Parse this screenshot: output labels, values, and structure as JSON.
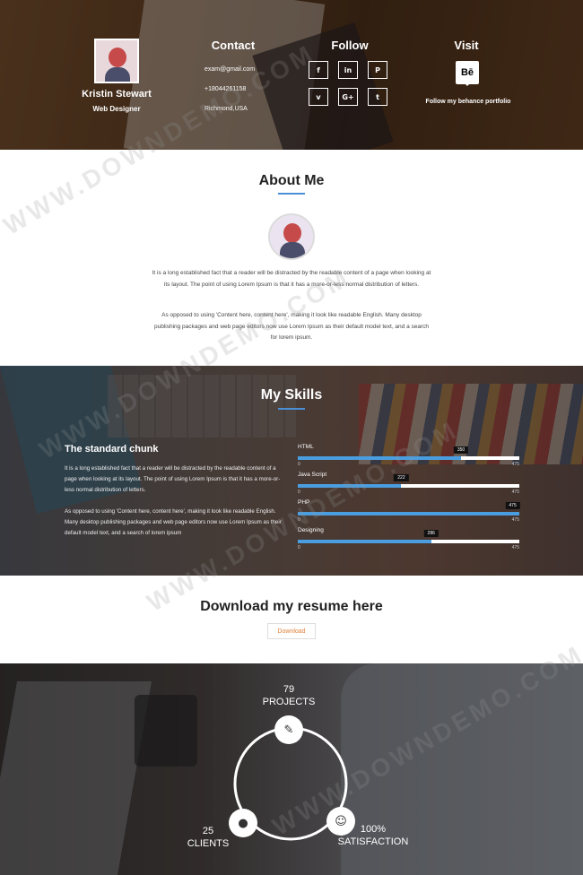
{
  "profile": {
    "name": "Kristin Stewart",
    "role": "Web Designer"
  },
  "contact": {
    "title": "Contact",
    "email": "exam@gmail.com",
    "phone": "+18044261158",
    "location": "Richmond,USA"
  },
  "follow": {
    "title": "Follow",
    "icons": [
      {
        "name": "facebook-icon",
        "glyph": "f"
      },
      {
        "name": "linkedin-icon",
        "glyph": "in"
      },
      {
        "name": "pinterest-icon",
        "glyph": "P"
      },
      {
        "name": "vimeo-icon",
        "glyph": "v"
      },
      {
        "name": "google-plus-icon",
        "glyph": "G+"
      },
      {
        "name": "tumblr-icon",
        "glyph": "t"
      }
    ]
  },
  "visit": {
    "title": "Visit",
    "icon": "behance-icon",
    "icon_text": "Bē",
    "text": "Follow my behance portfolio"
  },
  "about": {
    "title": "About Me",
    "p1": "It is a long established fact that a reader will be distracted by the readable content of a page when looking at its layout. The point of using Lorem Ipsum is that it has a more-or-less normal distribution of letters.",
    "p2": "As opposed to using 'Content here, content here', making it look like readable English. Many desktop publishing packages and web page editors now use Lorem Ipsum as their default model text, and a search for lorem ipsum."
  },
  "skills": {
    "title": "My Skills",
    "chunk_title": "The standard chunk",
    "chunk_p1": "It is a long established fact that a reader will be distracted by the readable content of a page when looking at its layout. The point of using Lorem Ipsum is that it has a more-or-less normal distribution of letters.",
    "chunk_p2": "As opposed to using 'Content here, content here', making it look like readable English. Many desktop publishing packages and web page editors now use Lorem Ipsum as their default model text, and a search of lorem ipsum",
    "bars": [
      {
        "label": "HTML",
        "value": 350,
        "max": 475,
        "min_label": "0",
        "max_label": "475"
      },
      {
        "label": "Java Script",
        "value": 222,
        "max": 475,
        "min_label": "0",
        "max_label": "475"
      },
      {
        "label": "PHP",
        "value": 475,
        "max": 475,
        "min_label": "0",
        "max_label": "475"
      },
      {
        "label": "Designing",
        "value": 286,
        "max": 475,
        "min_label": "0",
        "max_label": "475"
      }
    ]
  },
  "resume": {
    "title": "Download my resume here",
    "button": "Download"
  },
  "stats": {
    "projects": {
      "num": "79",
      "label": "PROJECTS",
      "icon": "edit-icon"
    },
    "clients": {
      "num": "25",
      "label": "CLIENTS",
      "icon": "user-icon"
    },
    "satisfaction": {
      "num": "100%",
      "label": "SATISFACTION",
      "icon": "smile-icon"
    }
  },
  "watermark": "WWW.DOWNDEMO.COM",
  "colors": {
    "accent": "#4a9ee0",
    "button_text": "#e0823a"
  }
}
